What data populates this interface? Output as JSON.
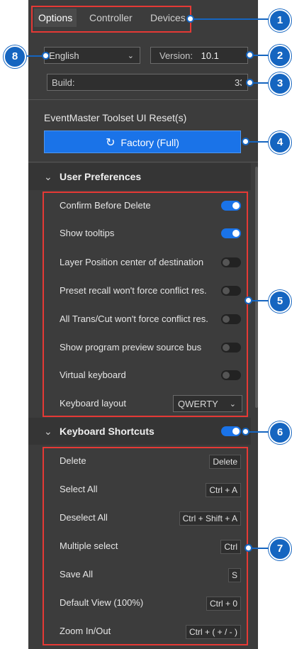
{
  "tabs": [
    "Options",
    "Controller",
    "Devices"
  ],
  "language": {
    "value": "English",
    "chevron": "chevron-down"
  },
  "version": {
    "label": "Version:",
    "value": "10.1"
  },
  "build": {
    "label": "Build:",
    "value": "33"
  },
  "reset": {
    "title": "EventMaster Toolset UI Reset(s)",
    "button_label": "Factory (Full)",
    "icon": "refresh"
  },
  "user_preferences": {
    "title": "User Preferences",
    "items": [
      {
        "label": "Confirm Before Delete",
        "on": true
      },
      {
        "label": "Show tooltips",
        "on": true
      },
      {
        "label": "Layer Position center of destination",
        "on": false
      },
      {
        "label": "Preset recall won't force conflict res.",
        "on": false
      },
      {
        "label": "All Trans/Cut won't force conflict res.",
        "on": false
      },
      {
        "label": "Show program preview source bus",
        "on": false
      },
      {
        "label": "Virtual keyboard",
        "on": false
      }
    ],
    "keyboard_layout": {
      "label": "Keyboard layout",
      "value": "QWERTY"
    }
  },
  "keyboard_shortcuts": {
    "title": "Keyboard Shortcuts",
    "enabled": true,
    "items": [
      {
        "label": "Delete",
        "key": "Delete"
      },
      {
        "label": "Select All",
        "key": "Ctrl + A"
      },
      {
        "label": "Deselect All",
        "key": "Ctrl + Shift + A"
      },
      {
        "label": "Multiple select",
        "key": "Ctrl"
      },
      {
        "label": "Save All",
        "key": "S"
      },
      {
        "label": "Default View (100%)",
        "key": "Ctrl + 0"
      },
      {
        "label": "Zoom In/Out",
        "key": "Ctrl + ( + / - )"
      }
    ]
  },
  "callouts": [
    "1",
    "2",
    "3",
    "4",
    "5",
    "6",
    "7",
    "8"
  ],
  "colors": {
    "panel": "#3c3c3c",
    "accent": "#1a73e8",
    "callout": "#1565c0",
    "highlight": "#e53935"
  }
}
